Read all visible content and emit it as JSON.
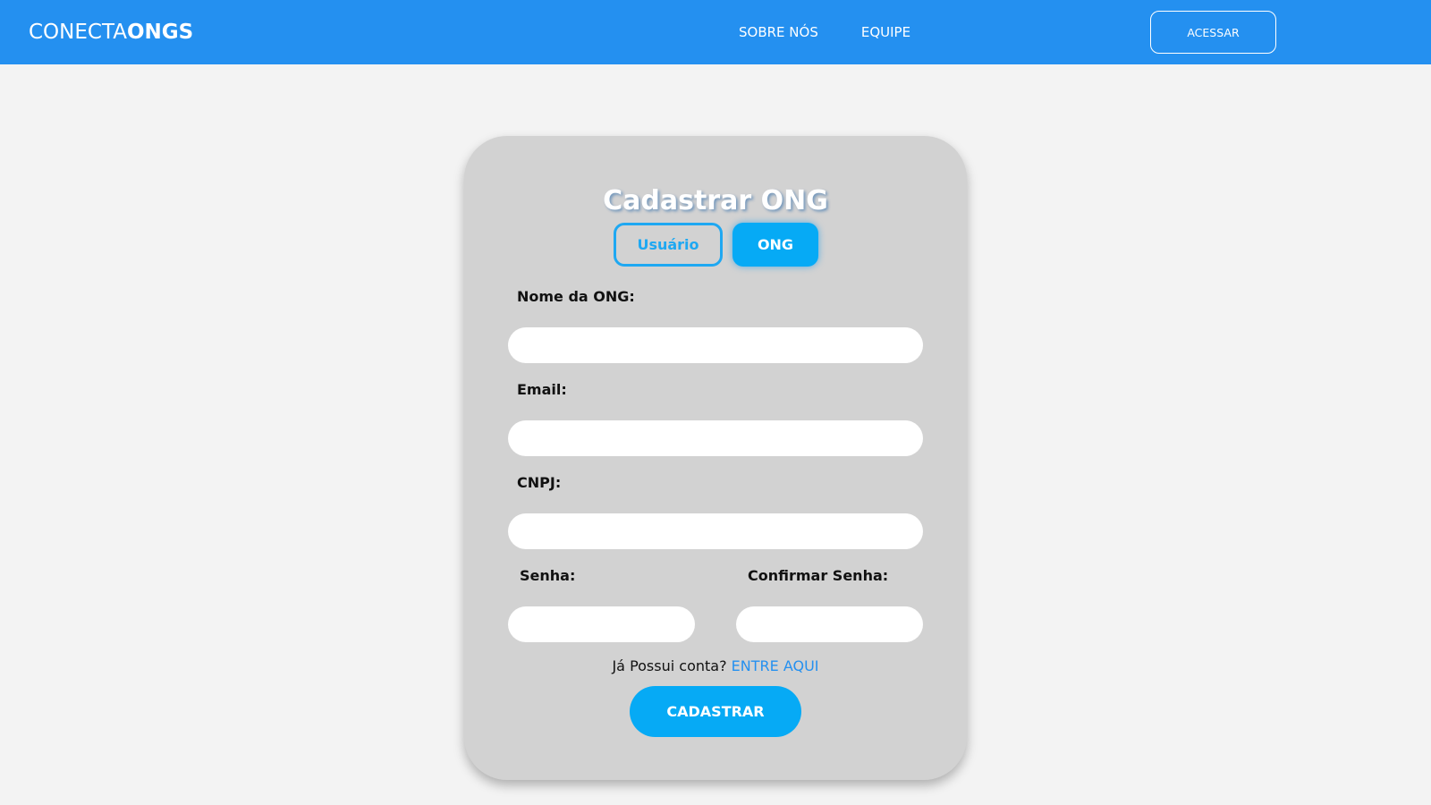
{
  "header": {
    "brand_light": "CONECTA",
    "brand_bold": "ONGS",
    "nav": [
      {
        "label": "SOBRE NÓS"
      },
      {
        "label": "EQUIPE"
      }
    ],
    "access_label": "ACESSAR"
  },
  "form": {
    "title": "Cadastrar ONG",
    "toggle_user": "Usuário",
    "toggle_ong": "ONG",
    "fields": {
      "name_label": "Nome da ONG:",
      "name_value": "",
      "email_label": "Email:",
      "email_value": "",
      "cnpj_label": "CNPJ:",
      "cnpj_value": "",
      "password_label": "Senha:",
      "password_value": "",
      "confirm_label": "Confirmar Senha:",
      "confirm_value": ""
    },
    "login_prompt": "Já Possui conta?",
    "login_link": "ENTRE AQUI",
    "submit_label": "CADASTRAR"
  },
  "colors": {
    "header_bg": "#2490f0",
    "accent": "#06aaf5",
    "card_bg": "#d2d2d2",
    "page_bg": "#f3f3f3"
  }
}
